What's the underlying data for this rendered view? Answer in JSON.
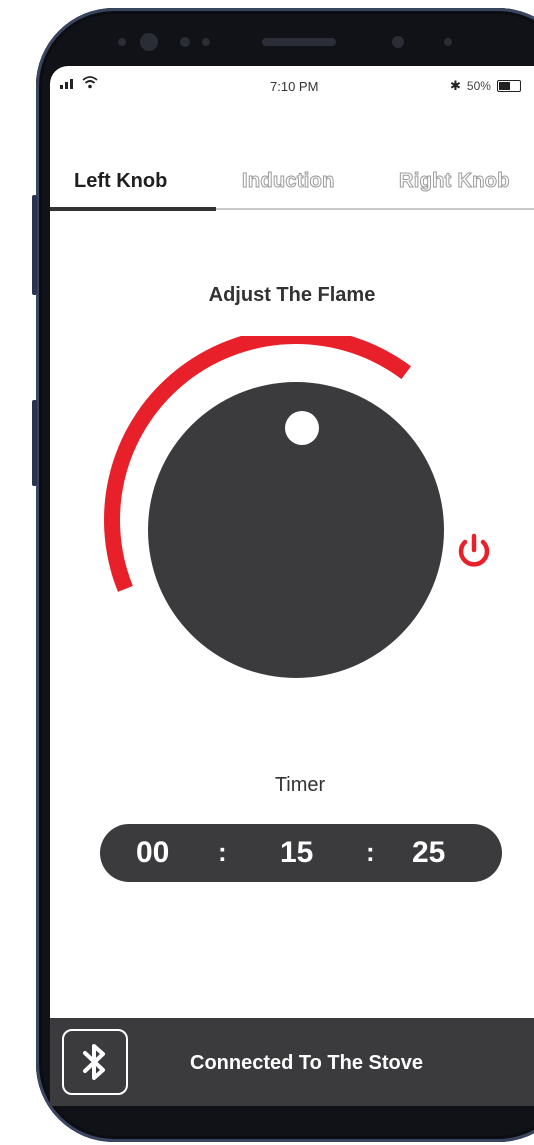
{
  "status_bar": {
    "time": "7:10 PM",
    "battery_text": "50%",
    "icons": [
      "signal-icon",
      "wifi-icon",
      "bluetooth-icon",
      "battery-icon"
    ]
  },
  "tabs": [
    {
      "label": "Left Knob",
      "active": true
    },
    {
      "label": "Induction",
      "active": false
    },
    {
      "label": "Right Knob",
      "active": false
    }
  ],
  "flame": {
    "heading": "Adjust The Flame",
    "level": 0.62,
    "accent_color": "#e8202a",
    "knob_color": "#3b3b3d"
  },
  "power": {
    "icon": "power-icon",
    "color": "#e8202a"
  },
  "timer": {
    "label": "Timer",
    "hours": "00",
    "minutes": "15",
    "seconds": "25",
    "separator": ":"
  },
  "connection": {
    "icon": "bluetooth-icon",
    "text": "Connected To The Stove"
  }
}
